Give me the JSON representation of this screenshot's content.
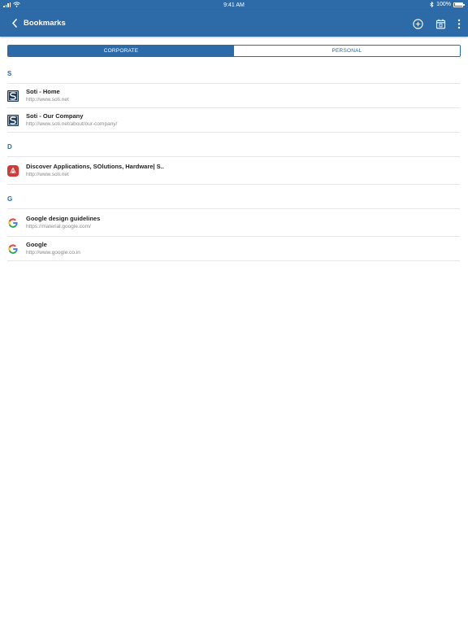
{
  "status_bar": {
    "time": "9:41 AM",
    "battery": "100%",
    "battery_level": 1.0
  },
  "nav": {
    "title": "Bookmarks",
    "back_icon": "chevron-left-icon",
    "actions": [
      {
        "name": "add-bookmark",
        "icon": "plus-circle-icon"
      },
      {
        "name": "calendar",
        "icon": "calendar-icon"
      },
      {
        "name": "more-options",
        "icon": "more-vertical-icon"
      }
    ]
  },
  "tabs": {
    "corporate": "CORPORATE",
    "personal": "PERSONAL",
    "selected": "corporate"
  },
  "sections": [
    {
      "header": "S",
      "items": [
        {
          "title": "Soti - Home",
          "url": "http://www.soti.net",
          "icon": "soti-logo-icon"
        },
        {
          "title": "Soti - Our Company",
          "url": "http://www.soti.net/about/our-company/",
          "icon": "soti-logo-icon"
        }
      ]
    },
    {
      "header": "D",
      "items": [
        {
          "title": "Discover Applications, SOlutions, Hardware| S..",
          "url": "http://www.soti.net",
          "icon": "discover-logo-icon"
        }
      ]
    },
    {
      "header": "G",
      "items": [
        {
          "title": "Google design guidelines",
          "url": "https://material.google.com/",
          "icon": "google-logo-icon"
        },
        {
          "title": "Google",
          "url": "http://www.google.co.in",
          "icon": "google-logo-icon"
        }
      ]
    }
  ],
  "colors": {
    "primary": "#2c6aa8",
    "section_header": "#2c6aa8",
    "url_text": "#8a8a8a",
    "divider": "#e6e6e6",
    "soti_logo": "#1f3b5a",
    "discover_logo": "#d23a3a"
  }
}
